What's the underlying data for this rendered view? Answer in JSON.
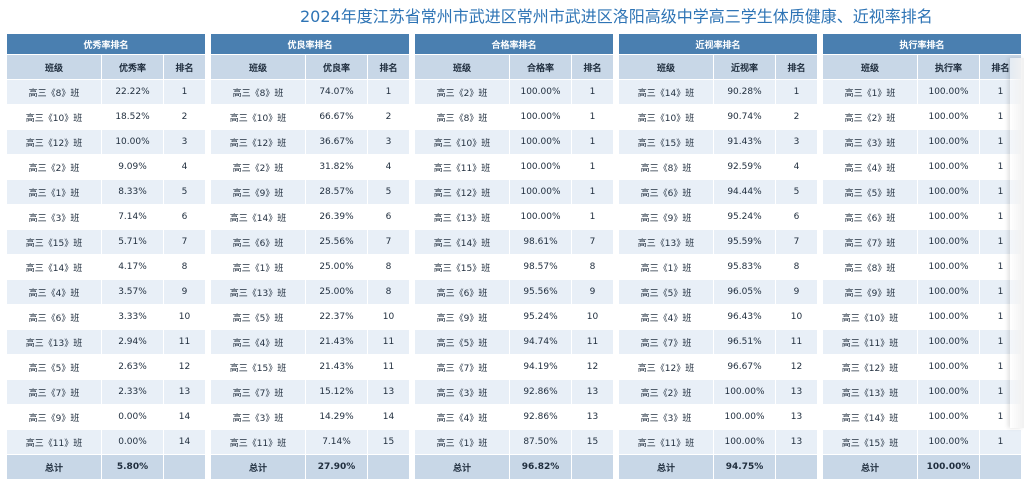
{
  "page": {
    "title": "2024年度江苏省常州市武进区常州市武进区洛阳高级中学高三学生体质健康、近视率排名"
  },
  "tables": [
    {
      "title": "优秀率排名",
      "headers": [
        "班级",
        "优秀率",
        "排名"
      ],
      "rows": [
        [
          "高三《8》班",
          "22.22%",
          "1"
        ],
        [
          "高三《10》班",
          "18.52%",
          "2"
        ],
        [
          "高三《12》班",
          "10.00%",
          "3"
        ],
        [
          "高三《2》班",
          "9.09%",
          "4"
        ],
        [
          "高三《1》班",
          "8.33%",
          "5"
        ],
        [
          "高三《3》班",
          "7.14%",
          "6"
        ],
        [
          "高三《15》班",
          "5.71%",
          "7"
        ],
        [
          "高三《14》班",
          "4.17%",
          "8"
        ],
        [
          "高三《4》班",
          "3.57%",
          "9"
        ],
        [
          "高三《6》班",
          "3.33%",
          "10"
        ],
        [
          "高三《13》班",
          "2.94%",
          "11"
        ],
        [
          "高三《5》班",
          "2.63%",
          "12"
        ],
        [
          "高三《7》班",
          "2.33%",
          "13"
        ],
        [
          "高三《9》班",
          "0.00%",
          "14"
        ],
        [
          "高三《11》班",
          "0.00%",
          "14"
        ]
      ],
      "total": [
        "总计",
        "5.80%",
        ""
      ]
    },
    {
      "title": "优良率排名",
      "headers": [
        "班级",
        "优良率",
        "排名"
      ],
      "rows": [
        [
          "高三《8》班",
          "74.07%",
          "1"
        ],
        [
          "高三《10》班",
          "66.67%",
          "2"
        ],
        [
          "高三《12》班",
          "36.67%",
          "3"
        ],
        [
          "高三《2》班",
          "31.82%",
          "4"
        ],
        [
          "高三《9》班",
          "28.57%",
          "5"
        ],
        [
          "高三《14》班",
          "26.39%",
          "6"
        ],
        [
          "高三《6》班",
          "25.56%",
          "7"
        ],
        [
          "高三《1》班",
          "25.00%",
          "8"
        ],
        [
          "高三《13》班",
          "25.00%",
          "8"
        ],
        [
          "高三《5》班",
          "22.37%",
          "10"
        ],
        [
          "高三《4》班",
          "21.43%",
          "11"
        ],
        [
          "高三《15》班",
          "21.43%",
          "11"
        ],
        [
          "高三《7》班",
          "15.12%",
          "13"
        ],
        [
          "高三《3》班",
          "14.29%",
          "14"
        ],
        [
          "高三《11》班",
          "7.14%",
          "15"
        ]
      ],
      "total": [
        "总计",
        "27.90%",
        ""
      ]
    },
    {
      "title": "合格率排名",
      "headers": [
        "班级",
        "合格率",
        "排名"
      ],
      "rows": [
        [
          "高三《2》班",
          "100.00%",
          "1"
        ],
        [
          "高三《8》班",
          "100.00%",
          "1"
        ],
        [
          "高三《10》班",
          "100.00%",
          "1"
        ],
        [
          "高三《11》班",
          "100.00%",
          "1"
        ],
        [
          "高三《12》班",
          "100.00%",
          "1"
        ],
        [
          "高三《13》班",
          "100.00%",
          "1"
        ],
        [
          "高三《14》班",
          "98.61%",
          "7"
        ],
        [
          "高三《15》班",
          "98.57%",
          "8"
        ],
        [
          "高三《6》班",
          "95.56%",
          "9"
        ],
        [
          "高三《9》班",
          "95.24%",
          "10"
        ],
        [
          "高三《5》班",
          "94.74%",
          "11"
        ],
        [
          "高三《7》班",
          "94.19%",
          "12"
        ],
        [
          "高三《3》班",
          "92.86%",
          "13"
        ],
        [
          "高三《4》班",
          "92.86%",
          "13"
        ],
        [
          "高三《1》班",
          "87.50%",
          "15"
        ]
      ],
      "total": [
        "总计",
        "96.82%",
        ""
      ]
    },
    {
      "title": "近视率排名",
      "headers": [
        "班级",
        "近视率",
        "排名"
      ],
      "rows": [
        [
          "高三《14》班",
          "90.28%",
          "1"
        ],
        [
          "高三《10》班",
          "90.74%",
          "2"
        ],
        [
          "高三《15》班",
          "91.43%",
          "3"
        ],
        [
          "高三《8》班",
          "92.59%",
          "4"
        ],
        [
          "高三《6》班",
          "94.44%",
          "5"
        ],
        [
          "高三《9》班",
          "95.24%",
          "6"
        ],
        [
          "高三《13》班",
          "95.59%",
          "7"
        ],
        [
          "高三《1》班",
          "95.83%",
          "8"
        ],
        [
          "高三《5》班",
          "96.05%",
          "9"
        ],
        [
          "高三《4》班",
          "96.43%",
          "10"
        ],
        [
          "高三《7》班",
          "96.51%",
          "11"
        ],
        [
          "高三《12》班",
          "96.67%",
          "12"
        ],
        [
          "高三《2》班",
          "100.00%",
          "13"
        ],
        [
          "高三《3》班",
          "100.00%",
          "13"
        ],
        [
          "高三《11》班",
          "100.00%",
          "13"
        ]
      ],
      "total": [
        "总计",
        "94.75%",
        ""
      ]
    },
    {
      "title": "执行率排名",
      "headers": [
        "班级",
        "执行率",
        "排名"
      ],
      "rows": [
        [
          "高三《1》班",
          "100.00%",
          "1"
        ],
        [
          "高三《2》班",
          "100.00%",
          "1"
        ],
        [
          "高三《3》班",
          "100.00%",
          "1"
        ],
        [
          "高三《4》班",
          "100.00%",
          "1"
        ],
        [
          "高三《5》班",
          "100.00%",
          "1"
        ],
        [
          "高三《6》班",
          "100.00%",
          "1"
        ],
        [
          "高三《7》班",
          "100.00%",
          "1"
        ],
        [
          "高三《8》班",
          "100.00%",
          "1"
        ],
        [
          "高三《9》班",
          "100.00%",
          "1"
        ],
        [
          "高三《10》班",
          "100.00%",
          "1"
        ],
        [
          "高三《11》班",
          "100.00%",
          "1"
        ],
        [
          "高三《12》班",
          "100.00%",
          "1"
        ],
        [
          "高三《13》班",
          "100.00%",
          "1"
        ],
        [
          "高三《14》班",
          "100.00%",
          "1"
        ],
        [
          "高三《15》班",
          "100.00%",
          "1"
        ]
      ],
      "total": [
        "总计",
        "100.00%",
        ""
      ]
    }
  ],
  "colors": {
    "title_text": "#2e74b5",
    "header_dark": "#4a7fb0",
    "header_light": "#c8d7e7",
    "row_alt": "#e8eff7"
  }
}
